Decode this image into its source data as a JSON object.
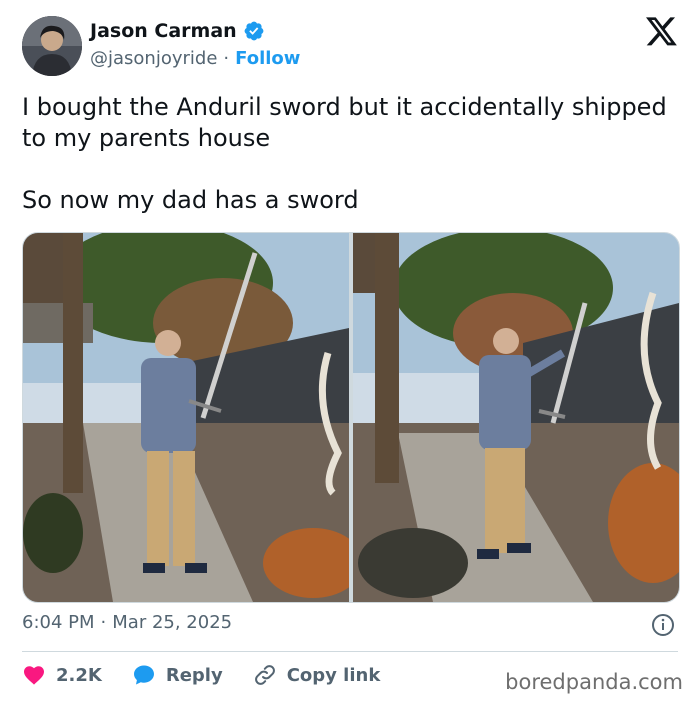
{
  "author": {
    "name": "Jason Carman",
    "handle": "@jasonjoyride",
    "separator": "·",
    "follow_label": "Follow"
  },
  "tweet": {
    "line1": "I bought the Anduril sword but it accidentally shipped to my parents house",
    "line2": "So now my dad has a sword"
  },
  "meta": {
    "time": "6:04 PM",
    "separator": "·",
    "date": "Mar 25, 2025"
  },
  "actions": {
    "likes": "2.2K",
    "reply_label": "Reply",
    "copy_label": "Copy link"
  },
  "watermark": "boredpanda.com",
  "colors": {
    "accent": "#1d9bf0",
    "like": "#f91880",
    "reply": "#1d9bf0",
    "muted": "#536471"
  },
  "icons": [
    "verified-badge-icon",
    "x-logo-icon",
    "info-icon",
    "heart-icon",
    "reply-bubble-icon",
    "link-icon"
  ]
}
